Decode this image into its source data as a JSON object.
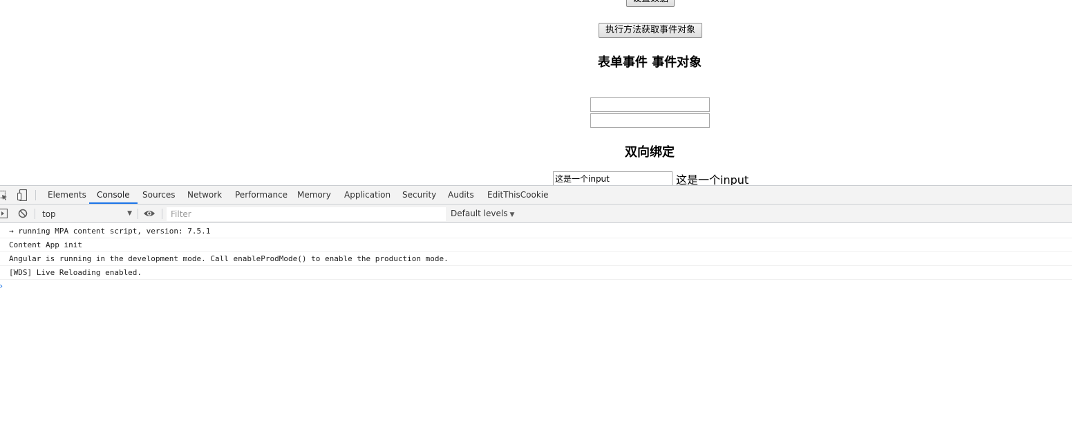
{
  "page": {
    "buttons": {
      "set_data": "设置数据",
      "get_event": "执行方法获取事件对象"
    },
    "headings": {
      "form_events": "表单事件 事件对象",
      "two_way_binding": "双向绑定"
    },
    "inputs": {
      "input_1_value": "",
      "input_2_value": "",
      "binding_value": "这是一个input"
    },
    "binding_echo": "这是一个input"
  },
  "devtools": {
    "tabs": [
      {
        "label": "Elements"
      },
      {
        "label": "Console",
        "active": true
      },
      {
        "label": "Sources"
      },
      {
        "label": "Network"
      },
      {
        "label": "Performance"
      },
      {
        "label": "Memory"
      },
      {
        "label": "Application"
      },
      {
        "label": "Security"
      },
      {
        "label": "Audits"
      },
      {
        "label": "EditThisCookie"
      }
    ],
    "icons": {
      "inspect": "inspect-element-icon",
      "device": "device-toolbar-icon",
      "sidebar": "console-sidebar-icon",
      "clear": "clear-console-icon",
      "eye": "live-expression-eye-icon",
      "prompt": "console-prompt-icon"
    },
    "toolbar": {
      "context": "top",
      "filter_placeholder": "Filter",
      "levels": "Default levels"
    },
    "messages": [
      "→ running MPA content script, version: 7.5.1",
      "Content App init",
      "Angular is running in the development mode. Call enableProdMode() to enable the production mode.",
      "[WDS] Live Reloading enabled."
    ],
    "colors": {
      "active_tab_underline": "#1a73e8",
      "prompt": "#1a73e8"
    }
  }
}
